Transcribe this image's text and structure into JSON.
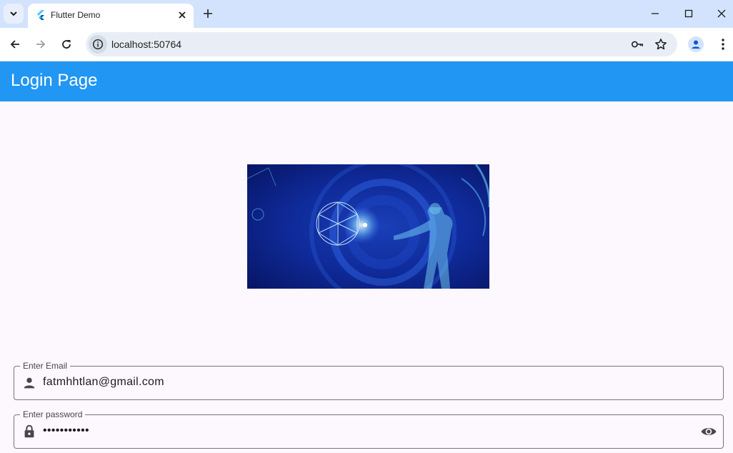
{
  "browser": {
    "tab_title": "Flutter Demo",
    "url": "localhost:50764",
    "icons": {
      "tab_search": "chevron-down-icon",
      "favicon": "flutter-icon",
      "tab_close": "close-icon",
      "new_tab": "plus-icon",
      "minimize": "minimize-icon",
      "maximize": "maximize-icon",
      "close_window": "close-icon",
      "back": "arrow-left-icon",
      "forward": "arrow-right-icon",
      "reload": "reload-icon",
      "site_info": "info-icon",
      "password": "key-icon",
      "bookmark": "star-icon",
      "profile": "person-icon",
      "menu": "more-vert-icon"
    }
  },
  "app": {
    "title": "Login Page",
    "accent": "#2196f3",
    "email": {
      "label": "Enter Email",
      "value": "fatmhhtlan@gmail.com",
      "icon": "person-icon"
    },
    "password": {
      "label": "Enter password",
      "value": "•••••••••••",
      "icon": "lock-icon",
      "suffix_icon": "eye-icon"
    }
  }
}
